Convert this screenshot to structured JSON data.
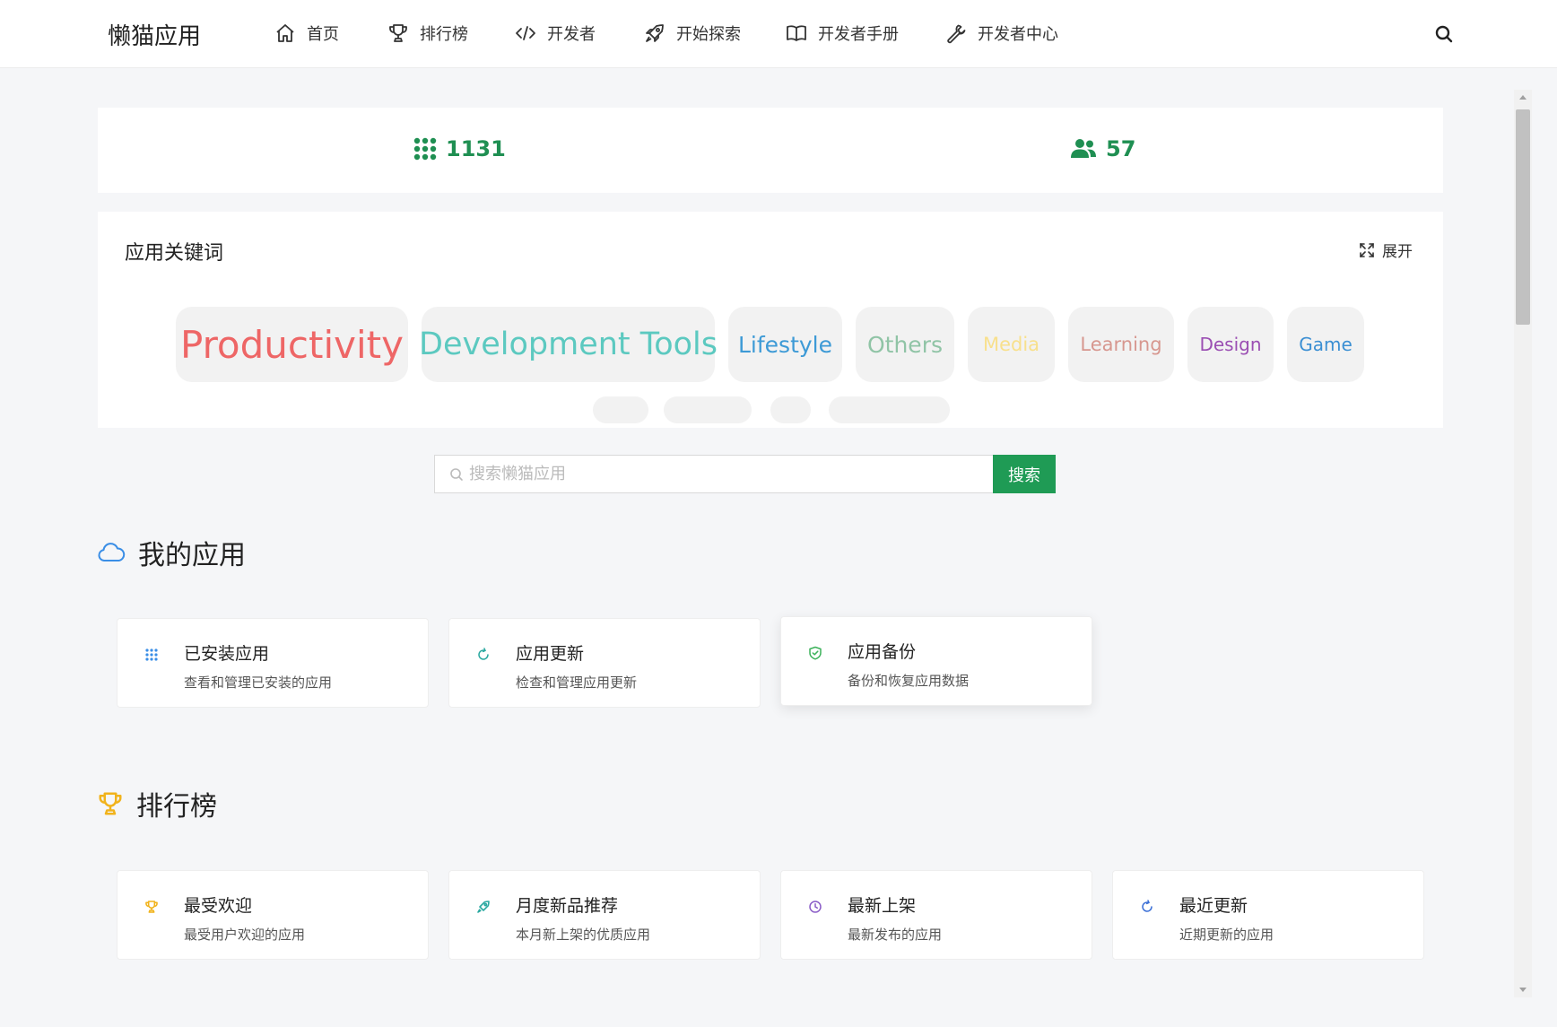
{
  "brand": "懒猫应用",
  "nav": [
    {
      "label": "首页",
      "icon": "home-icon"
    },
    {
      "label": "排行榜",
      "icon": "trophy-icon"
    },
    {
      "label": "开发者",
      "icon": "code-icon"
    },
    {
      "label": "开始探索",
      "icon": "rocket-icon"
    },
    {
      "label": "开发者手册",
      "icon": "book-icon"
    },
    {
      "label": "开发者中心",
      "icon": "wrench-icon"
    }
  ],
  "stats": {
    "apps_count": "1131",
    "developers_count": "57",
    "accent_color": "#1f8f52"
  },
  "keywords": {
    "title": "应用关键词",
    "expand_label": "展开",
    "tags": [
      {
        "label": "Productivity",
        "color": "#ee6666"
      },
      {
        "label": "Development Tools",
        "color": "#5cc9c0"
      },
      {
        "label": "Lifestyle",
        "color": "#3d9ad6"
      },
      {
        "label": "Others",
        "color": "#90c4a6"
      },
      {
        "label": "Media",
        "color": "#f8e08c"
      },
      {
        "label": "Learning",
        "color": "#d7978f"
      },
      {
        "label": "Design",
        "color": "#9b4fb3"
      },
      {
        "label": "Game",
        "color": "#3b8fd3"
      }
    ]
  },
  "search": {
    "placeholder": "搜索懒猫应用",
    "button_label": "搜索",
    "button_color": "#1f9b55"
  },
  "my_apps": {
    "title": "我的应用",
    "cards": [
      {
        "title": "已安装应用",
        "desc": "查看和管理已安装的应用",
        "icon": "grid-icon"
      },
      {
        "title": "应用更新",
        "desc": "检查和管理应用更新",
        "icon": "refresh-icon"
      },
      {
        "title": "应用备份",
        "desc": "备份和恢复应用数据",
        "icon": "shield-check-icon"
      }
    ]
  },
  "rankings": {
    "title": "排行榜",
    "cards": [
      {
        "title": "最受欢迎",
        "desc": "最受用户欢迎的应用",
        "icon": "trophy-icon"
      },
      {
        "title": "月度新品推荐",
        "desc": "本月新上架的优质应用",
        "icon": "rocket-icon"
      },
      {
        "title": "最新上架",
        "desc": "最新发布的应用",
        "icon": "clock-icon"
      },
      {
        "title": "最近更新",
        "desc": "近期更新的应用",
        "icon": "refresh-icon"
      }
    ]
  }
}
